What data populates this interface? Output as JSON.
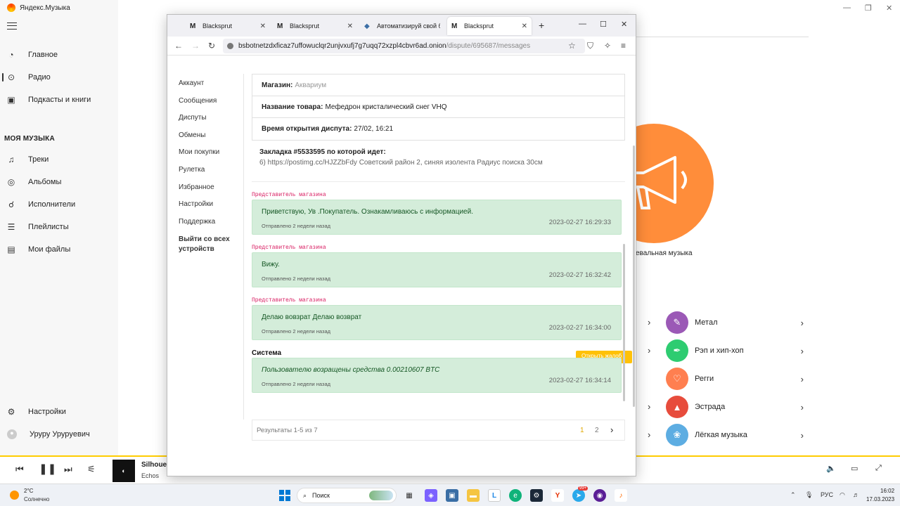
{
  "ym": {
    "app_title": "Яндекс.Музыка",
    "nav": [
      {
        "label": "Главное",
        "icon": "home-icon"
      },
      {
        "label": "Радио",
        "icon": "radio-icon"
      },
      {
        "label": "Подкасты и книги",
        "icon": "podcasts-icon"
      }
    ],
    "section_title": "МОЯ МУЗЫКА",
    "my_music": [
      {
        "label": "Треки",
        "icon": "note-icon"
      },
      {
        "label": "Альбомы",
        "icon": "disc-icon"
      },
      {
        "label": "Исполнители",
        "icon": "mic-icon"
      },
      {
        "label": "Плейлисты",
        "icon": "playlist-icon"
      },
      {
        "label": "Мои файлы",
        "icon": "folder-icon"
      }
    ],
    "settings_label": "Настройки",
    "user_name": "Уруру Урурyевич",
    "genre_caption": "евальная музыка",
    "genres": [
      {
        "label": "Метал",
        "color": "#9b59b6"
      },
      {
        "label": "Рэп и хип-хоп",
        "color": "#2ecc71"
      },
      {
        "label": "Регги",
        "color": "#ff7f50"
      },
      {
        "label": "Эстрада",
        "color": "#e74c3c"
      },
      {
        "label": "Лёгкая музыка",
        "color": "#5dade2"
      }
    ],
    "accent_color": "#ffcc00",
    "player": {
      "track": "Silhouett",
      "artist": "Echos"
    }
  },
  "browser": {
    "tabs": [
      {
        "label": "Blacksprut",
        "active": false
      },
      {
        "label": "Blacksprut",
        "active": false
      },
      {
        "label": "Автоматизируй свой бизнес",
        "active": false
      },
      {
        "label": "Blacksprut",
        "active": true
      }
    ],
    "url_host": "bsbotnetzdxficaz7uffowuclqr2unjvxufj7g7uqq72xzpl4cbvr6ad.onion",
    "url_path": "/dispute/695687/messages"
  },
  "page": {
    "menu": [
      "Аккаунт",
      "Сообщения",
      "Диспуты",
      "Обмены",
      "Мои покупки",
      "Рулетка",
      "Избранное",
      "Настройки",
      "Поддержка"
    ],
    "logout": "Выйти со всех устройств",
    "shop_label": "Магазин:",
    "shop_value": "Аквариум",
    "product_label": "Название товара:",
    "product_value": "Мефедрон кристалический снег VHQ",
    "opened_label": "Время открытия диспута:",
    "opened_value": "27/02, 16:21",
    "bookmark_title": "Закладка #5533595 по которой идет:",
    "bookmark_text": "6) https://postimg.cc/HJZZbFdy Советский район 2, синяя изолента Радиус поиска 30см",
    "messages": [
      {
        "sender": "Представитель магазина",
        "text": "Приветствую, Ув .Покупатель. Ознакамливаюсь с информацией.",
        "ago": "Отправлено 2 недели назад",
        "ts": "2023-02-27 16:29:33"
      },
      {
        "sender": "Представитель магазина",
        "text": "Вижу.",
        "ago": "Отправлено 2 недели назад",
        "ts": "2023-02-27 16:32:42"
      },
      {
        "sender": "Представитель магазина",
        "text": "Делаю вовзрат Делаю возврат",
        "ago": "Отправлено 2 недели назад",
        "ts": "2023-02-27 16:34:00"
      },
      {
        "sender": "Система",
        "text": "Пользователю возращены средства 0.00210607 BTC",
        "ago": "Отправлено 2 недели назад",
        "ts": "2023-02-27 16:34:14"
      }
    ],
    "open_button": "Открыть жалоб",
    "results": "Результаты 1-5 из 7",
    "pages": [
      "1",
      "2"
    ],
    "msg_color": "#d4edda",
    "sender_color": "#d81b60"
  },
  "taskbar": {
    "temp": "2°C",
    "weather": "Солнечно",
    "search_placeholder": "Поиск",
    "lang": "РУС",
    "time": "16:02",
    "date": "17.03.2023",
    "badge": "99+"
  }
}
